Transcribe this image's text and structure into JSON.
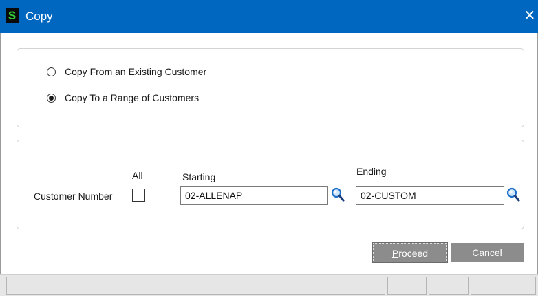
{
  "window": {
    "title": "Copy",
    "logo_letter": "S",
    "close_glyph": "✕"
  },
  "copy_mode": {
    "options": [
      {
        "label": "Copy From an Existing Customer",
        "selected": false
      },
      {
        "label": "Copy To a Range of Customers",
        "selected": true
      }
    ]
  },
  "range": {
    "row_label": "Customer Number",
    "all_label": "All",
    "all_checked": false,
    "starting_label": "Starting",
    "starting_value": "02-ALLENAP",
    "ending_label": "Ending",
    "ending_value": "02-CUSTOM",
    "lookup_icon": "magnifier-icon"
  },
  "buttons": {
    "proceed": {
      "accel": "P",
      "rest": "roceed"
    },
    "cancel": {
      "accel": "C",
      "rest": "ancel"
    }
  },
  "colors": {
    "titlebar": "#0067c0",
    "button": "#8c8c8c",
    "logo_text": "#32d13a"
  }
}
